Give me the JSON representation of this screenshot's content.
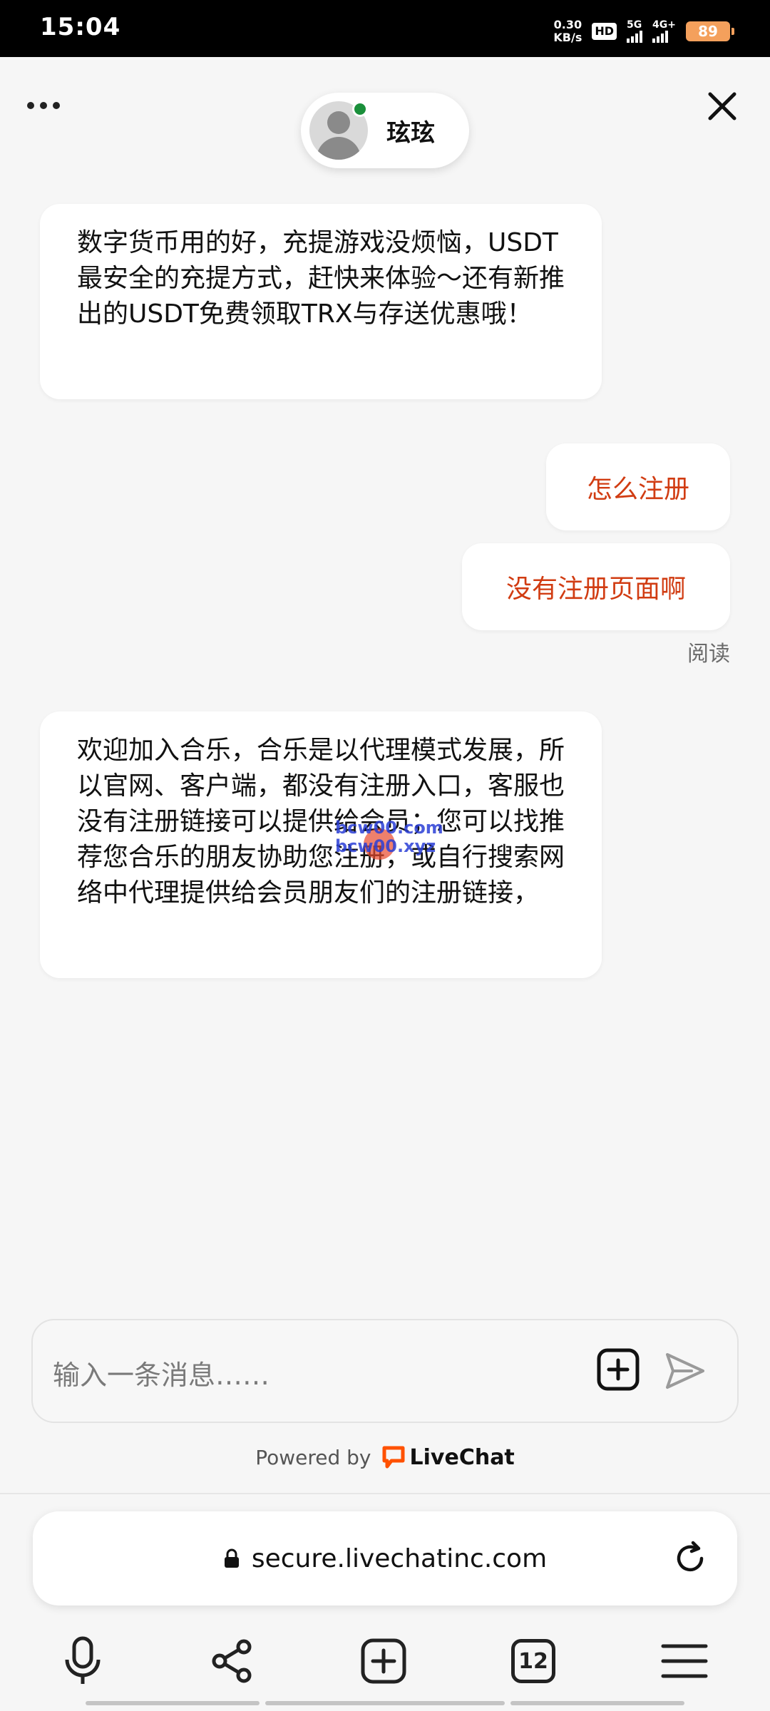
{
  "status_bar": {
    "time": "15:04",
    "net_speed_value": "0.30",
    "net_speed_unit": "KB/s",
    "hd_label": "HD",
    "sig1_label": "5G",
    "sig2_label": "4G+",
    "battery": "89"
  },
  "header": {
    "agent_name": "玹玹",
    "agent_online": true
  },
  "messages": {
    "agent_1": "数字货币用的好，充提游戏没烦恼，USDT最安全的充提方式，赶快来体验～还有新推出的USDT免费领取TRX与存送优惠哦！",
    "user_1": "怎么注册",
    "user_2": "没有注册页面啊",
    "read_status": "阅读",
    "agent_2": "欢迎加入合乐，合乐是以代理模式发展，所以官网、客户端，都没有注册入口，客服也没有注册链接可以提供给会员；您可以找推荐您合乐的朋友协助您注册，或自行搜索网络中代理提供给会员朋友们的注册链接，"
  },
  "watermark": {
    "line1": "bcw00.com",
    "line2": "bcw00.xyz"
  },
  "composer": {
    "placeholder": "输入一条消息……"
  },
  "footer": {
    "powered_by": "Powered by",
    "brand": "LiveChat"
  },
  "browser": {
    "url": "secure.livechatinc.com",
    "tab_count": "12"
  },
  "colors": {
    "user_text": "#d13c12",
    "online": "#1a8f3a",
    "brand_orange": "#ff5100"
  }
}
